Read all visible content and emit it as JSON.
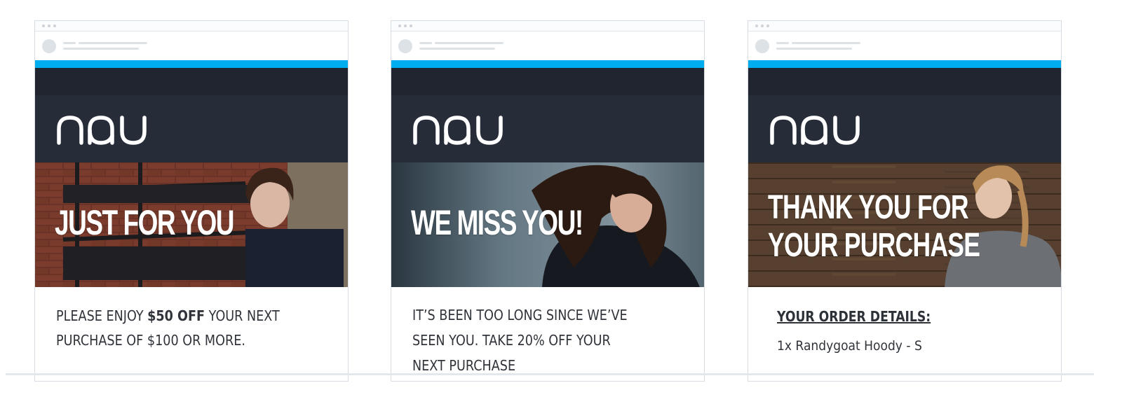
{
  "colors": {
    "accent": "#00adef",
    "nav_dark": "#202530",
    "logo_band": "#272d38",
    "text": "#30343a"
  },
  "logo_text": "nau",
  "cards": [
    {
      "hero_title": "JUST FOR YOU",
      "body": {
        "line1_pre": "PLEASE ENJOY ",
        "line1_bold": "$50 OFF",
        "line1_post": " YOUR NEXT",
        "line2": "PURCHASE OF $100 OR MORE."
      }
    },
    {
      "hero_title": "WE MISS YOU!",
      "body": {
        "line1": "IT’S BEEN TOO LONG SINCE WE’VE",
        "line2": "SEEN YOU. TAKE 20% OFF YOUR",
        "line3": "NEXT PURCHASE"
      }
    },
    {
      "hero_title_line1": "THANK YOU FOR",
      "hero_title_line2": "YOUR PURCHASE",
      "order_heading": "YOUR ORDER DETAILS:",
      "order_item": "1x Randygoat Hoody - S"
    }
  ]
}
